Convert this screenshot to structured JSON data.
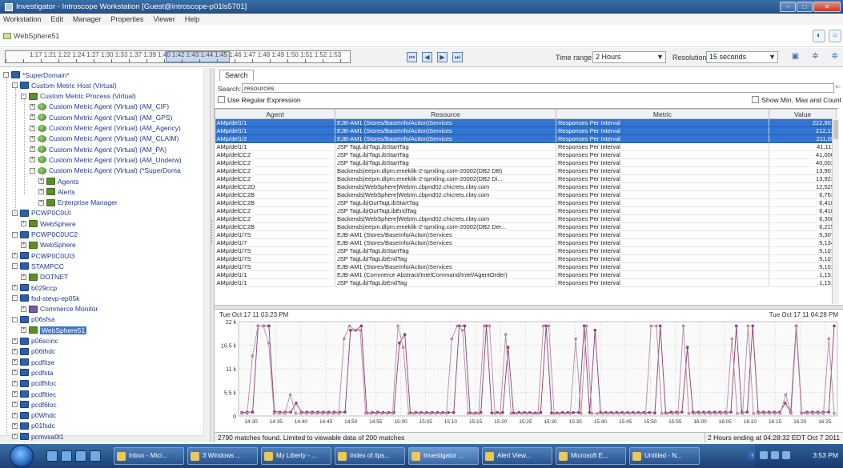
{
  "window": {
    "title": "Investigator - Introscope Workstation [Guest@introscope-p01ls5701]"
  },
  "menu": [
    "Workstation",
    "Edit",
    "Manager",
    "Properties",
    "Viewer",
    "Help"
  ],
  "instance_label": "WebSphere51",
  "timeline": {
    "ticks_text": "1:17 1:21 1:22 1:24 1:27 1:30 1:33 1:37 1:39 1:40 1:42 1:43 1:44 1:45 1:46 1:47 1:48 1:49 1:50 1:51 1:52 1:53",
    "time_range_label": "Time range:",
    "time_range_value": "2 Hours",
    "resolution_label": "Resolution:",
    "resolution_value": "15 seconds"
  },
  "tree": {
    "items": [
      {
        "label": "*SuperDomain*",
        "indent": 0,
        "icon": "ico-monitor",
        "exp": "-"
      },
      {
        "label": "Custom Metric Host (Virtual)",
        "indent": 1,
        "icon": "ico-monitor",
        "exp": "-"
      },
      {
        "label": "Custom Metric Process (Virtual)",
        "indent": 2,
        "icon": "ico-folder",
        "exp": "-"
      },
      {
        "label": "Custom Metric Agent (Virtual) (AM_CIF)",
        "indent": 3,
        "icon": "ico-agent",
        "exp": "+"
      },
      {
        "label": "Custom Metric Agent (Virtual) (AM_GPS)",
        "indent": 3,
        "icon": "ico-agent",
        "exp": "+"
      },
      {
        "label": "Custom Metric Agent (Virtual) (AM_Agency)",
        "indent": 3,
        "icon": "ico-agent",
        "exp": "+"
      },
      {
        "label": "Custom Metric Agent (Virtual) (AM_CLAIM)",
        "indent": 3,
        "icon": "ico-agent",
        "exp": "+"
      },
      {
        "label": "Custom Metric Agent (Virtual) (AM_PA)",
        "indent": 3,
        "icon": "ico-agent",
        "exp": "+"
      },
      {
        "label": "Custom Metric Agent (Virtual) (AM_Underw)",
        "indent": 3,
        "icon": "ico-agent",
        "exp": "+"
      },
      {
        "label": "Custom Metric Agent (Virtual) (*SuperDoma",
        "indent": 3,
        "icon": "ico-agent",
        "exp": "-"
      },
      {
        "label": "Agents",
        "indent": 4,
        "icon": "ico-folder",
        "exp": "+"
      },
      {
        "label": "Alerts",
        "indent": 4,
        "icon": "ico-folder",
        "exp": "+"
      },
      {
        "label": "Enterprise Manager",
        "indent": 4,
        "icon": "ico-folder",
        "exp": "+"
      },
      {
        "label": "PCWP0C0UI",
        "indent": 1,
        "icon": "ico-monitor",
        "exp": "-"
      },
      {
        "label": "WebSphere",
        "indent": 2,
        "icon": "ico-folder",
        "exp": "+"
      },
      {
        "label": "PCWP0C0UC2",
        "indent": 1,
        "icon": "ico-monitor",
        "exp": "-"
      },
      {
        "label": "WebSphere",
        "indent": 2,
        "icon": "ico-folder",
        "exp": "+"
      },
      {
        "label": "PCWP0C0UI3",
        "indent": 1,
        "icon": "ico-monitor",
        "exp": "+"
      },
      {
        "label": "STAMPCC",
        "indent": 1,
        "icon": "ico-monitor",
        "exp": "-"
      },
      {
        "label": "DOTNET",
        "indent": 2,
        "icon": "ico-folder",
        "exp": "+"
      },
      {
        "label": "b029ccp",
        "indent": 1,
        "icon": "ico-monitor",
        "exp": "+"
      },
      {
        "label": "fsd-stevp-ep05k",
        "indent": 1,
        "icon": "ico-monitor",
        "exp": "-"
      },
      {
        "label": "Commerce Monitor",
        "indent": 2,
        "icon": "ico-fold2",
        "exp": "+"
      },
      {
        "label": "p06sfsa",
        "indent": 1,
        "icon": "ico-monitor",
        "exp": "-"
      },
      {
        "label": "WebSphere51",
        "indent": 2,
        "icon": "ico-folder",
        "exp": "+",
        "selected": true
      },
      {
        "label": "p06scinc",
        "indent": 1,
        "icon": "ico-monitor",
        "exp": "+"
      },
      {
        "label": "p06thdc",
        "indent": 1,
        "icon": "ico-monitor",
        "exp": "+"
      },
      {
        "label": "pcdfitse",
        "indent": 1,
        "icon": "ico-monitor",
        "exp": "+"
      },
      {
        "label": "pcdfsta",
        "indent": 1,
        "icon": "ico-monitor",
        "exp": "+"
      },
      {
        "label": "pcdfhloc",
        "indent": 1,
        "icon": "ico-monitor",
        "exp": "+"
      },
      {
        "label": "pcdfltiec",
        "indent": 1,
        "icon": "ico-monitor",
        "exp": "+"
      },
      {
        "label": "pcdf6loc",
        "indent": 1,
        "icon": "ico-monitor",
        "exp": "+"
      },
      {
        "label": "p0Whdc",
        "indent": 1,
        "icon": "ico-monitor",
        "exp": "+"
      },
      {
        "label": "p01fsdc",
        "indent": 1,
        "icon": "ico-monitor",
        "exp": "+"
      },
      {
        "label": "pcmvsa0l1",
        "indent": 1,
        "icon": "ico-monitor",
        "exp": "+"
      },
      {
        "label": "pcmvsa0CC",
        "indent": 1,
        "icon": "ico-monitor",
        "exp": "+"
      }
    ]
  },
  "right": {
    "tab_label": "Search",
    "search_label": "Search:",
    "search_value": "resources",
    "clear_glyph": "<-",
    "regex_label": "Use Regular Expression",
    "showmin_label": "Show Min, Max and Count",
    "columns": [
      "Agent",
      "Resource",
      "Metric",
      "Value"
    ],
    "rows": [
      {
        "agent": "AMp/del1/1",
        "resource": "EJB-AM1 (Stores/BaseInfo/Action)Services",
        "metric": "Responses Per Interval",
        "value": "222,901",
        "sel": true
      },
      {
        "agent": "AMp/del1/1",
        "resource": "EJB-AM1 (Stores/BaseInfo/Action)Services",
        "metric": "Responses Per Interval",
        "value": "212,12",
        "sel": true
      },
      {
        "agent": "AMp/del1/2",
        "resource": "EJB-AM1 (Stores/BaseInfo/Action)Services",
        "metric": "Responses Per Interval",
        "value": "211,09",
        "sel": true
      },
      {
        "agent": "AMp/del1/1",
        "resource": "JSP TagLib|TagLibStartTag",
        "metric": "Responses Per Interval",
        "value": "41,111",
        "sel": false
      },
      {
        "agent": "AMp/delCC2",
        "resource": "JSP TagLib|TagLibStartTag",
        "metric": "Responses Per Interval",
        "value": "41,000",
        "sel": false
      },
      {
        "agent": "AMp/delCC2",
        "resource": "JSP TagLib|TagLibStartTag",
        "metric": "Responses Per Interval",
        "value": "40,002",
        "sel": false
      },
      {
        "agent": "AMp/delCC2",
        "resource": "Backends|eepm.dlpm.emeklik-2-sprxling.com-20002(DB2 DB)",
        "metric": "Responses Per Interval",
        "value": "13,907",
        "sel": false
      },
      {
        "agent": "AMp/delCC2",
        "resource": "Backends|eepm.dlpm.emeklik-2-sprxling.com-20002(DB2 Di...",
        "metric": "Responses Per Interval",
        "value": "13,923",
        "sel": false
      },
      {
        "agent": "AMp/delCC2D",
        "resource": "Backends|WebSphere|WebIm.cbpnd02.chicrets.cbty.com",
        "metric": "Responses Per Interval",
        "value": "12,525",
        "sel": false
      },
      {
        "agent": "AMp/delCC2B",
        "resource": "Backends|WebSphere|WebIm.cbpnd02.chicrets.cbty.com",
        "metric": "Responses Per Interval",
        "value": "6,763",
        "sel": false
      },
      {
        "agent": "AMp/delCC2B",
        "resource": "JSP TagLib|OutTagLibStartTag",
        "metric": "Responses Per Interval",
        "value": "6,410",
        "sel": false
      },
      {
        "agent": "AMp/delCC2",
        "resource": "JSP TagLib|OutTagLibEndTag",
        "metric": "Responses Per Interval",
        "value": "6,410",
        "sel": false
      },
      {
        "agent": "AMp/delCC2",
        "resource": "Backends|WebSphere|WebIm.cbpnd02.chicrets.cbty.com",
        "metric": "Responses Per Interval",
        "value": "6,308",
        "sel": false
      },
      {
        "agent": "AMp/delCC2B",
        "resource": "Backends|eepm.dlpm.emeklik-2-sprxling.com-20002(DB2 Der...",
        "metric": "Responses Per Interval",
        "value": "6,215",
        "sel": false
      },
      {
        "agent": "AMp/del1/7S",
        "resource": "EJB-AM1 (Stores/BaseInfo/Action)Services",
        "metric": "Responses Per Interval",
        "value": "5,307",
        "sel": false
      },
      {
        "agent": "AMp/del1/7",
        "resource": "EJB-AM1 (Stores/BaseInfo/Action)Services",
        "metric": "Responses Per Interval",
        "value": "5,134",
        "sel": false
      },
      {
        "agent": "AMp/del1/7S",
        "resource": "JSP TagLib|TagLibStartTag",
        "metric": "Responses Per Interval",
        "value": "5,107",
        "sel": false
      },
      {
        "agent": "AMp/del1/7S",
        "resource": "JSP TagLib|TagLibEndTag",
        "metric": "Responses Per Interval",
        "value": "5,107",
        "sel": false
      },
      {
        "agent": "AMp/del1/7S",
        "resource": "EJB-AM1 (Stores/BaseInfo/Action)Services",
        "metric": "Responses Per Interval",
        "value": "5,101",
        "sel": false
      },
      {
        "agent": "AMp/del1/1",
        "resource": "EJB-AM1 (Commerce Abstract/IntelCommand/Intel/AgentOrder)",
        "metric": "Responses Per Interval",
        "value": "1,151",
        "sel": false
      },
      {
        "agent": "AMp/del1/1",
        "resource": "JSP TagLib|TagLibEndTag",
        "metric": "Responses Per Interval",
        "value": "1,151",
        "sel": false
      }
    ],
    "chart_ts_left": "Tue Oct 17 11 03:23 PM",
    "chart_ts_right": "Tue Oct 17 11 04:28 PM",
    "status_left": "2790 matches found. Limited to viewable data of 200 matches",
    "status_right": "2 Hours ending at 04:28:32 EDT Oct 7 2011"
  },
  "chart_data": {
    "type": "line",
    "ylim": [
      0,
      22000
    ],
    "y_ticks": [
      {
        "value": 22000,
        "label": "22 k"
      },
      {
        "value": 16500,
        "label": "16.5 k"
      },
      {
        "value": 11000,
        "label": "11 k"
      },
      {
        "value": 5500,
        "label": "5.5 k"
      },
      {
        "value": 0,
        "label": "0"
      }
    ],
    "x_ticks": [
      "14:30",
      "14:35",
      "14:40",
      "14:45",
      "14:50",
      "14:55",
      "15:00",
      "15:05",
      "15:10",
      "15:15",
      "15:20",
      "15:25",
      "15:30",
      "15:35",
      "15:40",
      "15:45",
      "15:50",
      "15:55",
      "16:00",
      "16:05",
      "16:10",
      "16:15",
      "16:20",
      "16:25"
    ],
    "grid": true,
    "series": [
      {
        "color": "#8b3a7a",
        "values": [
          800,
          900,
          900,
          21000,
          21000,
          21000,
          1000,
          900,
          900,
          900,
          3000,
          900,
          900,
          900,
          900,
          900,
          900,
          900,
          900,
          900,
          20000,
          20000,
          21000,
          700,
          800,
          900,
          800,
          800,
          800,
          17000,
          19000,
          700,
          800,
          800,
          800,
          800,
          800,
          800,
          800,
          800,
          21000,
          21000,
          700,
          700,
          800,
          21000,
          700,
          800,
          800,
          16000,
          700,
          800,
          800,
          800,
          700,
          800,
          21000,
          700,
          700,
          800,
          800,
          800,
          800,
          21000,
          800,
          20000,
          800,
          800,
          800,
          800,
          800,
          800,
          800,
          800,
          800,
          800,
          700,
          21000,
          700,
          900,
          900,
          900,
          16000,
          900,
          900,
          900,
          900,
          900,
          900,
          900,
          900,
          21000,
          900,
          900,
          21000,
          900,
          900,
          900,
          900,
          900,
          3000,
          900,
          21000,
          700,
          900,
          900,
          900,
          900,
          900,
          21000
        ]
      },
      {
        "color": "#b58aa2",
        "values": [
          600,
          600,
          14000,
          21000,
          21000,
          17000,
          600,
          600,
          600,
          5000,
          600,
          600,
          600,
          600,
          600,
          600,
          600,
          600,
          600,
          18000,
          21000,
          20000,
          20000,
          600,
          600,
          600,
          600,
          600,
          600,
          21000,
          16000,
          600,
          600,
          600,
          600,
          600,
          600,
          600,
          600,
          18000,
          21000,
          20000,
          600,
          600,
          600,
          21000,
          21000,
          600,
          600,
          19000,
          600,
          600,
          600,
          600,
          600,
          600,
          21000,
          21000,
          600,
          600,
          600,
          600,
          18000,
          600,
          21000,
          600,
          600,
          600,
          600,
          600,
          600,
          600,
          600,
          600,
          600,
          600,
          21000,
          21000,
          600,
          600,
          600,
          600,
          21000,
          600,
          600,
          600,
          600,
          600,
          600,
          600,
          600,
          18000,
          600,
          600,
          21000,
          600,
          600,
          600,
          600,
          600,
          600,
          5000,
          600,
          21000,
          600,
          600,
          600,
          600,
          600,
          18000,
          600
        ]
      }
    ]
  },
  "taskbar": {
    "tasks": [
      "Inbox - Micr...",
      "3 Windows ...",
      "My Liberty - ...",
      "Index of /ips...",
      "Investigator ...",
      "Alert View...",
      "Microsoft E...",
      "Untitled - N..."
    ],
    "active_index": 4,
    "clock": "3:53 PM"
  }
}
